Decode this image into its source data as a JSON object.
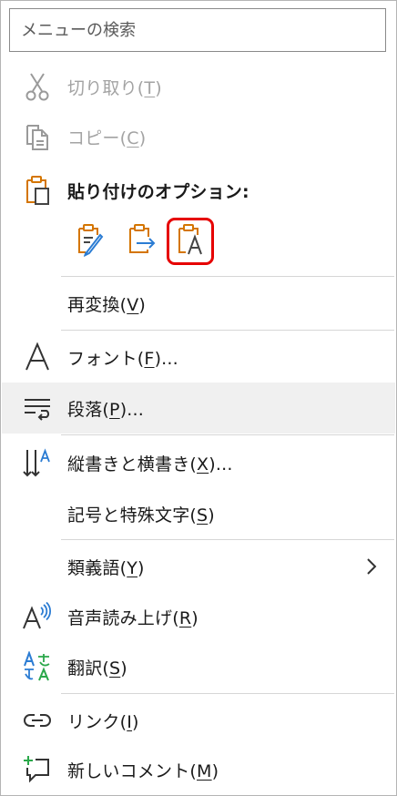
{
  "search": {
    "placeholder": "メニューの検索"
  },
  "items": {
    "cut": {
      "text": "切り取り(",
      "key": "T",
      "tail": ")"
    },
    "copy": {
      "text": "コピー(",
      "key": "C",
      "tail": ")"
    },
    "paste_options": {
      "label": "貼り付けのオプション:"
    },
    "reconvert": {
      "text": "再変換(",
      "key": "V",
      "tail": ")"
    },
    "font": {
      "text": "フォント(",
      "key": "F",
      "tail": ")..."
    },
    "paragraph": {
      "text": "段落(",
      "key": "P",
      "tail": ")..."
    },
    "text_direction": {
      "text": "縦書きと横書き(",
      "key": "X",
      "tail": ")..."
    },
    "symbols": {
      "text": "記号と特殊文字(",
      "key": "S",
      "tail": ")"
    },
    "thesaurus": {
      "text": "類義語(",
      "key": "Y",
      "tail": ")"
    },
    "read_aloud": {
      "text": "音声読み上げ(",
      "key": "R",
      "tail": ")"
    },
    "translate": {
      "text": "翻訳(",
      "key": "S",
      "tail": ")"
    },
    "link": {
      "text": "リンク(",
      "key": "I",
      "tail": ")"
    },
    "new_comment": {
      "text": "新しいコメント(",
      "key": "M",
      "tail": ")"
    }
  },
  "colors": {
    "accent_orange": "#d47500",
    "accent_blue": "#2b7cd3",
    "highlight_red": "#e60000",
    "hover_bg": "#f0f0f0"
  },
  "icons": {
    "cut": "scissors-icon",
    "copy": "copy-icon",
    "paste_options": "clipboard-icon",
    "paste_keep_format": "paste-keep-formatting-icon",
    "paste_merge": "paste-merge-formatting-icon",
    "paste_text_only": "paste-text-only-icon",
    "font": "font-letter-a-icon",
    "paragraph": "paragraph-icon",
    "text_direction": "text-direction-icon",
    "thesaurus_more": "chevron-right-icon",
    "read_aloud": "read-aloud-icon",
    "translate": "translate-icon",
    "link": "link-icon",
    "new_comment": "new-comment-icon"
  }
}
